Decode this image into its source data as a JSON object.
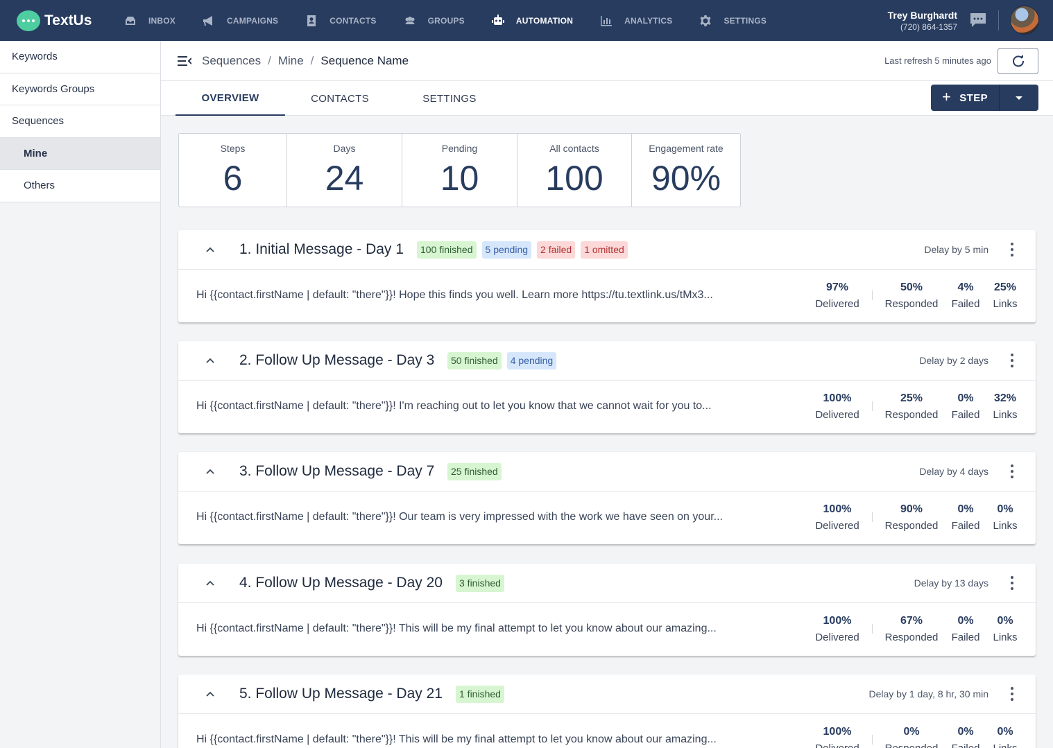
{
  "app": {
    "name": "TextUs"
  },
  "nav": [
    {
      "label": "INBOX",
      "icon": "inbox-icon",
      "active": false
    },
    {
      "label": "CAMPAIGNS",
      "icon": "megaphone-icon",
      "active": false
    },
    {
      "label": "CONTACTS",
      "icon": "contact-card-icon",
      "active": false
    },
    {
      "label": "GROUPS",
      "icon": "people-icon",
      "active": false
    },
    {
      "label": "AUTOMATION",
      "icon": "robot-icon",
      "active": true
    },
    {
      "label": "ANALYTICS",
      "icon": "bar-chart-icon",
      "active": false
    },
    {
      "label": "SETTINGS",
      "icon": "gear-icon",
      "active": false
    }
  ],
  "user": {
    "name": "Trey Burghardt",
    "phone": "(720) 864-1357"
  },
  "sidebar": {
    "items": [
      {
        "label": "Keywords"
      },
      {
        "label": "Keywords Groups"
      },
      {
        "label": "Sequences"
      },
      {
        "label": "Mine"
      },
      {
        "label": "Others"
      }
    ]
  },
  "breadcrumb": [
    "Sequences",
    "Mine",
    "Sequence Name"
  ],
  "header": {
    "refresh_text": "Last refresh 5 minutes ago"
  },
  "tabs": [
    {
      "label": "OVERVIEW"
    },
    {
      "label": "CONTACTS"
    },
    {
      "label": "SETTINGS"
    }
  ],
  "step_button": {
    "label": "STEP"
  },
  "stats": [
    {
      "label": "Steps",
      "value": "6"
    },
    {
      "label": "Days",
      "value": "24"
    },
    {
      "label": "Pending",
      "value": "10"
    },
    {
      "label": "All contacts",
      "value": "100"
    },
    {
      "label": "Engagement rate",
      "value": "90%"
    }
  ],
  "steps": [
    {
      "title": "1. Initial Message - Day 1",
      "badges": [
        {
          "text": "100 finished",
          "kind": "green"
        },
        {
          "text": "5 pending",
          "kind": "blue"
        },
        {
          "text": "2 failed",
          "kind": "red"
        },
        {
          "text": "1 omitted",
          "kind": "red"
        }
      ],
      "delay": "Delay by 5 min",
      "message": "Hi {{contact.firstName | default: \"there\"}}! Hope this finds you well. Learn more https://tu.textlink.us/tMx3...",
      "metrics": {
        "delivered": "97%",
        "responded": "50%",
        "failed": "4%",
        "links": "25%"
      }
    },
    {
      "title": "2. Follow Up Message - Day 3",
      "badges": [
        {
          "text": "50 finished",
          "kind": "green"
        },
        {
          "text": "4 pending",
          "kind": "blue"
        }
      ],
      "delay": "Delay by 2 days",
      "message": "Hi {{contact.firstName | default: \"there\"}}! I'm reaching out to let you know that we cannot wait for you to...",
      "metrics": {
        "delivered": "100%",
        "responded": "25%",
        "failed": "0%",
        "links": "32%"
      }
    },
    {
      "title": "3. Follow Up Message - Day 7",
      "badges": [
        {
          "text": "25 finished",
          "kind": "green"
        }
      ],
      "delay": "Delay by 4 days",
      "message": "Hi {{contact.firstName | default: \"there\"}}! Our team is very impressed with the work we have seen on your...",
      "metrics": {
        "delivered": "100%",
        "responded": "90%",
        "failed": "0%",
        "links": "0%"
      }
    },
    {
      "title": "4. Follow Up Message - Day 20",
      "badges": [
        {
          "text": "3 finished",
          "kind": "green"
        }
      ],
      "delay": "Delay by 13 days",
      "message": "Hi {{contact.firstName | default: \"there\"}}! This will be my final attempt to let you know about our amazing...",
      "metrics": {
        "delivered": "100%",
        "responded": "67%",
        "failed": "0%",
        "links": "0%"
      }
    },
    {
      "title": "5. Follow Up Message - Day 21",
      "badges": [
        {
          "text": "1 finished",
          "kind": "green"
        }
      ],
      "delay": "Delay by 1 day, 8 hr, 30 min",
      "message": "Hi {{contact.firstName | default: \"there\"}}! This will be my final attempt to let you know about our amazing...",
      "metrics": {
        "delivered": "100%",
        "responded": "0%",
        "failed": "0%",
        "links": "0%"
      }
    }
  ],
  "metric_labels": {
    "delivered": "Delivered",
    "responded": "Responded",
    "failed": "Failed",
    "links": "Links"
  },
  "colors": {
    "nav_bg": "#283c5f",
    "accent": "#283c5f",
    "green_badge": "#d7f5d1",
    "blue_badge": "#d6e7fb",
    "red_badge": "#fcd8d8"
  }
}
